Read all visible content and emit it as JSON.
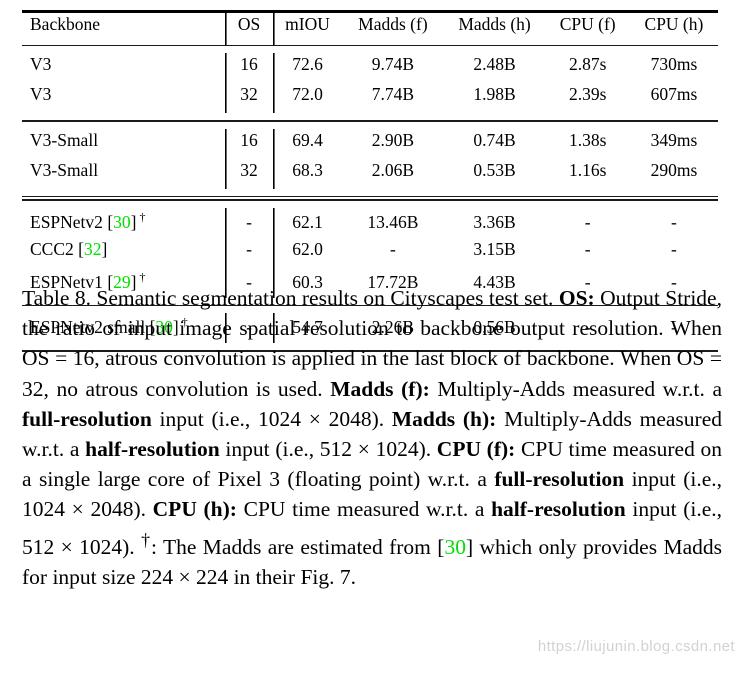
{
  "table": {
    "columns": [
      "Backbone",
      "OS",
      "mIOU",
      "Madds (f)",
      "Madds (h)",
      "CPU (f)",
      "CPU (h)"
    ],
    "groups": [
      {
        "rows": [
          {
            "backbone": "V3",
            "cite": "",
            "dagger": false,
            "os": "16",
            "miou": "72.6",
            "madds_f": "9.74B",
            "madds_h": "2.48B",
            "cpu_f": "2.87s",
            "cpu_h": "730ms"
          },
          {
            "backbone": "V3",
            "cite": "",
            "dagger": false,
            "os": "32",
            "miou": "72.0",
            "madds_f": "7.74B",
            "madds_h": "1.98B",
            "cpu_f": "2.39s",
            "cpu_h": "607ms"
          }
        ]
      },
      {
        "rows": [
          {
            "backbone": "V3-Small",
            "cite": "",
            "dagger": false,
            "os": "16",
            "miou": "69.4",
            "madds_f": "2.90B",
            "madds_h": "0.74B",
            "cpu_f": "1.38s",
            "cpu_h": "349ms"
          },
          {
            "backbone": "V3-Small",
            "cite": "",
            "dagger": false,
            "os": "32",
            "miou": "68.3",
            "madds_f": "2.06B",
            "madds_h": "0.53B",
            "cpu_f": "1.16s",
            "cpu_h": "290ms"
          }
        ]
      },
      {
        "rows": [
          {
            "backbone": "ESPNetv2",
            "cite": "30",
            "dagger": true,
            "os": "-",
            "miou": "62.1",
            "madds_f": "13.46B",
            "madds_h": "3.36B",
            "cpu_f": "-",
            "cpu_h": "-"
          },
          {
            "backbone": "CCC2",
            "cite": "32",
            "dagger": false,
            "os": "-",
            "miou": "62.0",
            "madds_f": "-",
            "madds_h": "3.15B",
            "cpu_f": "-",
            "cpu_h": "-"
          },
          {
            "backbone": "ESPNetv1",
            "cite": "29",
            "dagger": true,
            "os": "-",
            "miou": "60.3",
            "madds_f": "17.72B",
            "madds_h": "4.43B",
            "cpu_f": "-",
            "cpu_h": "-"
          }
        ]
      },
      {
        "rows": [
          {
            "backbone": "ESPNetv2 small",
            "cite": "30",
            "dagger": true,
            "os": "-",
            "miou": "54.7",
            "madds_f": "2.26B",
            "madds_h": "0.56B",
            "cpu_f": "-",
            "cpu_h": "-"
          }
        ]
      }
    ]
  },
  "caption": {
    "label": "Table 8.",
    "s1": " Semantic segmentation results on Cityscapes test set. ",
    "b_os": "OS:",
    "s2": " Output Stride, the ratio of input image spatial resolution to backbone output resolution. When OS = 16, atrous convolution is applied in the last block of backbone. When OS = 32, no atrous convolution is used. ",
    "b_maddsf": "Madds (f):",
    "s3": " Multiply-Adds measured w.r.t. a ",
    "b_fullres1": "full-resolution",
    "s4": " input (i.e., 1024 × 2048). ",
    "b_maddsh": "Madds (h):",
    "s5": " Multiply-Adds measured w.r.t. a ",
    "b_halfres1": "half-resolution",
    "s6": " input (i.e., 512 × 1024). ",
    "b_cpuf": "CPU (f):",
    "s7": " CPU time measured on a single large core of Pixel 3 (floating point) w.r.t. a ",
    "b_fullres2": "full-resolution",
    "s8": " input (i.e., 1024 × 2048). ",
    "b_cpuh": "CPU (h):",
    "s9": " CPU time measured w.r.t. a ",
    "b_halfres2": "half-resolution",
    "s10": " input (i.e., 512 × 1024). ",
    "dagger_mark": "†",
    "s11": ": The Madds are estimated from ",
    "cite_ref": "30",
    "s12": " which only provides Madds for input size 224 × 224 in their Fig. 7."
  },
  "watermark": {
    "text": "https://liujunin.blog.csdn.net"
  },
  "colors": {
    "citation_green": "#00e000",
    "text_black": "#000000",
    "background": "#ffffff",
    "watermark_gray": "#d2d2d2"
  }
}
